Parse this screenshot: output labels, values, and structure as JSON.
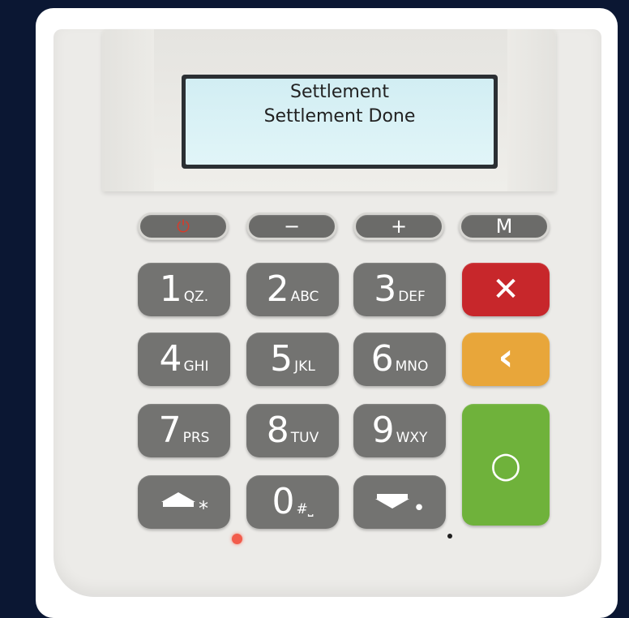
{
  "screen": {
    "line1": "Settlement",
    "line2": "Settlement Done"
  },
  "function_keys": [
    {
      "name": "power",
      "label": "⏻"
    },
    {
      "name": "minus",
      "label": "−"
    },
    {
      "name": "plus",
      "label": "+"
    },
    {
      "name": "menu",
      "label": "M"
    }
  ],
  "keys": {
    "k1": {
      "digit": "1",
      "letters": "QZ."
    },
    "k2": {
      "digit": "2",
      "letters": "ABC"
    },
    "k3": {
      "digit": "3",
      "letters": "DEF"
    },
    "k4": {
      "digit": "4",
      "letters": "GHI"
    },
    "k5": {
      "digit": "5",
      "letters": "JKL"
    },
    "k6": {
      "digit": "6",
      "letters": "MNO"
    },
    "k7": {
      "digit": "7",
      "letters": "PRS"
    },
    "k8": {
      "digit": "8",
      "letters": "TUV"
    },
    "k9": {
      "digit": "9",
      "letters": "WXY"
    },
    "k0": {
      "digit": "0",
      "letters": "#⎵"
    },
    "up": {
      "symbol": "*"
    },
    "down": {
      "symbol": "•"
    }
  },
  "action_keys": {
    "cancel": "✕",
    "clear": "‹",
    "enter": "○"
  },
  "colors": {
    "cancel": "#c7272b",
    "clear": "#e8a63a",
    "enter": "#6fb23b",
    "power": "#d63b2b",
    "led": "#f25c4c"
  }
}
